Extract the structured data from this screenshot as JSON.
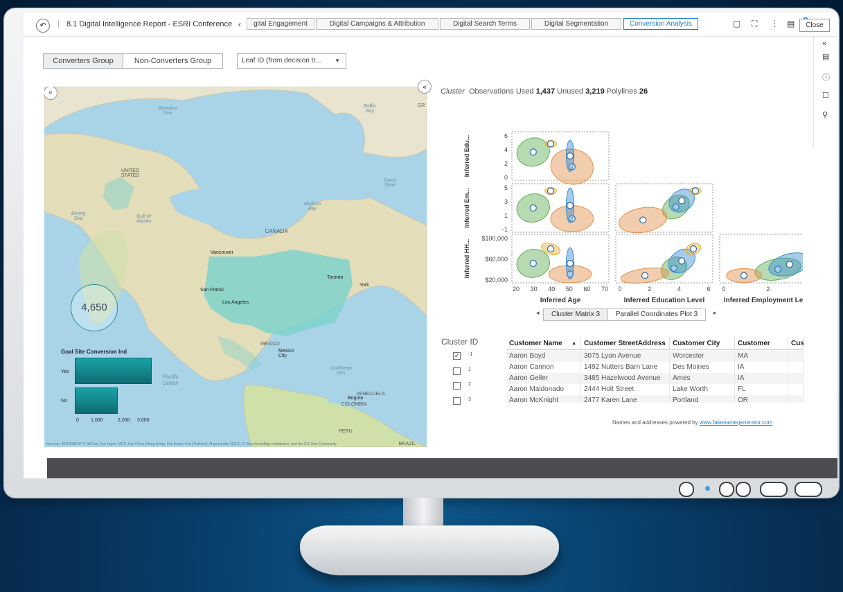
{
  "topbar": {
    "report_title": "8.1 Digital Intelligence Report - ESRI Conference",
    "tabs": [
      "gital Engagement",
      "Digital Campaigns & Attribution",
      "Digital Search Terms",
      "Digital Segmentation",
      "Conversion Analysis"
    ],
    "active_tab": "Conversion Analysis",
    "notification_count": "1",
    "close_label": "Close"
  },
  "controls": {
    "groups": [
      "Converters Group",
      "Non-Converters Group"
    ],
    "active_group": "Converters Group",
    "dropdown_value": "Leaf ID (from decision tr..."
  },
  "map": {
    "count": "4,650",
    "labels": {
      "beaufort": "Beaufort Sea",
      "baffin": "Baffin Bay",
      "davis": "Davis Strait",
      "hudson": "Hudson Bay",
      "gulf_alaska": "Gulf of Alaska",
      "bering": "Bering Sea",
      "united_states": "UNITED STATES",
      "canada": "CANADA",
      "mexico": "MÉXICO",
      "pacific": "Pacific Ocean",
      "caribbean": "Caribbean Sea",
      "venezuela": "VENEZUELA",
      "colombia": "COLOMBIA",
      "peru": "PERU",
      "brazil": "BRAZIL",
      "gr": "GR"
    },
    "cities": {
      "vancouver": "Vancouver",
      "san_francisco": "San Franci",
      "los_angeles": "Los Angeles",
      "toronto": "Toronto",
      "new_york": "York",
      "mexico_city": "Mexico City",
      "bogota": "Bogota"
    },
    "attribution": "Intermap, INCREMENT P, NRCan, Esri Japan, METI, Esri China (Hong Kong), Esri Korea, Esri (Thailand), MapmyIndia, NGCC, © OpenStreetMap contributors, and the GIS User Community",
    "bar_chart": {
      "title": "Goal Site Conversion Ind",
      "categories": [
        "Yes",
        "No"
      ],
      "values": [
        3000,
        1650
      ],
      "ticks": [
        "0",
        "1,000",
        "2,000",
        "3,000"
      ]
    }
  },
  "cluster": {
    "label": "Cluster",
    "observations_used_label": "Observations Used",
    "observations_used": "1,437",
    "unused_label": "Unused",
    "unused": "3,219",
    "polylines_label": "Polylines",
    "polylines": "26"
  },
  "chart_data": {
    "type": "scatter",
    "row_labels": [
      "Inferred Edu...",
      "Inferred Em...",
      "Inferred HH..."
    ],
    "col_labels": [
      "Inferred Age",
      "Inferred Education Level",
      "Inferred Employment Level"
    ],
    "row_ticks": [
      [
        "0",
        "2",
        "4",
        "6"
      ],
      [
        "-1",
        "1",
        "3",
        "5"
      ],
      [
        "$20,000",
        "$60,000",
        "$100,000"
      ]
    ],
    "col_ticks": [
      [
        "20",
        "30",
        "40",
        "50",
        "60",
        "70"
      ],
      [
        "0",
        "2",
        "4",
        "6"
      ],
      [
        "0",
        "2",
        "4"
      ]
    ],
    "clusters": [
      {
        "color": "#5fae55"
      },
      {
        "color": "#e0904a"
      },
      {
        "color": "#3a8fd0"
      },
      {
        "color": "#e9b23a"
      }
    ]
  },
  "viz_tabs": [
    "Cluster Matrix 3",
    "Parallel Coordinates Plot 3"
  ],
  "active_viz_tab": "Cluster Matrix 3",
  "cluster_filter": {
    "title": "Cluster ID",
    "items": [
      {
        "label": "-1",
        "checked": "✓"
      },
      {
        "label": "1",
        "checked": ""
      },
      {
        "label": "2",
        "checked": ""
      },
      {
        "label": "3",
        "checked": ""
      }
    ]
  },
  "table": {
    "headers": [
      "Customer Name",
      "Customer StreetAddress",
      "Customer City",
      "Customer State",
      "Cus"
    ],
    "sort_indicator": "▲",
    "rows": [
      [
        "Aaron Boyd",
        "3075 Lyon Avenue",
        "Worcester",
        "MA"
      ],
      [
        "Aaron Cannon",
        "1492 Nutters Barn Lane",
        "Des Moines",
        "IA"
      ],
      [
        "Aaron Geller",
        "3485 Hazelwood Avenue",
        "Ames",
        "IA"
      ],
      [
        "Aaron Maldonado",
        "2444 Holt Street",
        "Lake Worth",
        "FL"
      ],
      [
        "Aaron McKnight",
        "2477 Karen Lane",
        "Portland",
        "OR"
      ]
    ]
  },
  "footer": {
    "note": "Names and addresses powered by",
    "link": "www.fakenamegenerator.com"
  }
}
